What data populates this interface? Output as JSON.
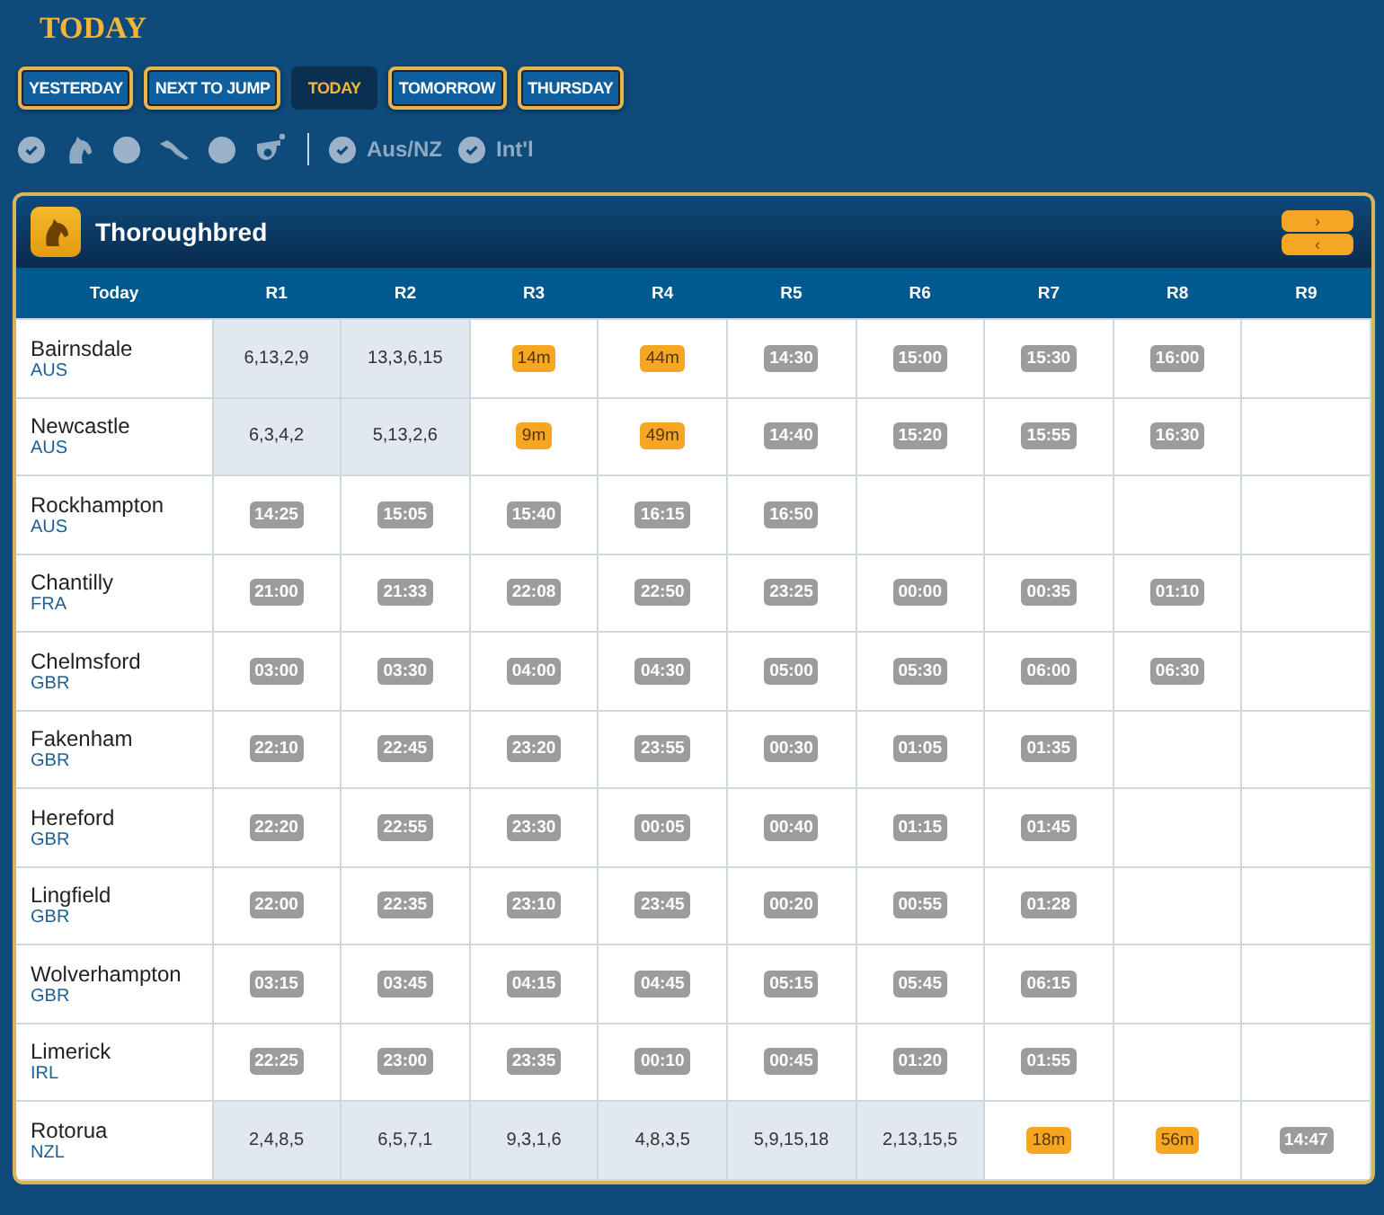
{
  "page_title": "TODAY",
  "day_tabs": [
    {
      "label": "YESTERDAY",
      "selected": false
    },
    {
      "label": "NEXT TO JUMP",
      "selected": false
    },
    {
      "label": "TODAY",
      "selected": true
    },
    {
      "label": "TOMORROW",
      "selected": false
    },
    {
      "label": "THURSDAY",
      "selected": false
    }
  ],
  "type_filters": [
    {
      "kind": "thoroughbred",
      "checked": true
    },
    {
      "kind": "greyhound",
      "checked": false
    },
    {
      "kind": "harness",
      "checked": false
    }
  ],
  "region_filters": [
    {
      "label": "Aus/NZ",
      "checked": true
    },
    {
      "label": "Int'l",
      "checked": true
    }
  ],
  "panel": {
    "title": "Thoroughbred",
    "nav_buttons": [
      "›",
      "‹"
    ],
    "venue_header": "Today",
    "race_headers": [
      "R1",
      "R2",
      "R3",
      "R4",
      "R5",
      "R6",
      "R7",
      "R8",
      "R9"
    ],
    "rows": [
      {
        "venue": "Bairnsdale",
        "country": "AUS",
        "cells": [
          {
            "kind": "result",
            "text": "6,13,2,9"
          },
          {
            "kind": "result",
            "text": "13,3,6,15"
          },
          {
            "kind": "soon",
            "text": "14m"
          },
          {
            "kind": "soon",
            "text": "44m"
          },
          {
            "kind": "time",
            "text": "14:30"
          },
          {
            "kind": "time",
            "text": "15:00"
          },
          {
            "kind": "time",
            "text": "15:30"
          },
          {
            "kind": "time",
            "text": "16:00"
          }
        ]
      },
      {
        "venue": "Newcastle",
        "country": "AUS",
        "cells": [
          {
            "kind": "result",
            "text": "6,3,4,2"
          },
          {
            "kind": "result",
            "text": "5,13,2,6"
          },
          {
            "kind": "soon",
            "text": "9m"
          },
          {
            "kind": "soon",
            "text": "49m"
          },
          {
            "kind": "time",
            "text": "14:40"
          },
          {
            "kind": "time",
            "text": "15:20"
          },
          {
            "kind": "time",
            "text": "15:55"
          },
          {
            "kind": "time",
            "text": "16:30"
          }
        ]
      },
      {
        "venue": "Rockhampton",
        "country": "AUS",
        "cells": [
          {
            "kind": "time",
            "text": "14:25"
          },
          {
            "kind": "time",
            "text": "15:05"
          },
          {
            "kind": "time",
            "text": "15:40"
          },
          {
            "kind": "time",
            "text": "16:15"
          },
          {
            "kind": "time",
            "text": "16:50"
          }
        ]
      },
      {
        "venue": "Chantilly",
        "country": "FRA",
        "cells": [
          {
            "kind": "time",
            "text": "21:00"
          },
          {
            "kind": "time",
            "text": "21:33"
          },
          {
            "kind": "time",
            "text": "22:08"
          },
          {
            "kind": "time",
            "text": "22:50"
          },
          {
            "kind": "time",
            "text": "23:25"
          },
          {
            "kind": "time",
            "text": "00:00"
          },
          {
            "kind": "time",
            "text": "00:35"
          },
          {
            "kind": "time",
            "text": "01:10"
          }
        ]
      },
      {
        "venue": "Chelmsford",
        "country": "GBR",
        "cells": [
          {
            "kind": "time",
            "text": "03:00"
          },
          {
            "kind": "time",
            "text": "03:30"
          },
          {
            "kind": "time",
            "text": "04:00"
          },
          {
            "kind": "time",
            "text": "04:30"
          },
          {
            "kind": "time",
            "text": "05:00"
          },
          {
            "kind": "time",
            "text": "05:30"
          },
          {
            "kind": "time",
            "text": "06:00"
          },
          {
            "kind": "time",
            "text": "06:30"
          }
        ]
      },
      {
        "venue": "Fakenham",
        "country": "GBR",
        "cells": [
          {
            "kind": "time",
            "text": "22:10"
          },
          {
            "kind": "time",
            "text": "22:45"
          },
          {
            "kind": "time",
            "text": "23:20"
          },
          {
            "kind": "time",
            "text": "23:55"
          },
          {
            "kind": "time",
            "text": "00:30"
          },
          {
            "kind": "time",
            "text": "01:05"
          },
          {
            "kind": "time",
            "text": "01:35"
          }
        ]
      },
      {
        "venue": "Hereford",
        "country": "GBR",
        "cells": [
          {
            "kind": "time",
            "text": "22:20"
          },
          {
            "kind": "time",
            "text": "22:55"
          },
          {
            "kind": "time",
            "text": "23:30"
          },
          {
            "kind": "time",
            "text": "00:05"
          },
          {
            "kind": "time",
            "text": "00:40"
          },
          {
            "kind": "time",
            "text": "01:15"
          },
          {
            "kind": "time",
            "text": "01:45"
          }
        ]
      },
      {
        "venue": "Lingfield",
        "country": "GBR",
        "cells": [
          {
            "kind": "time",
            "text": "22:00"
          },
          {
            "kind": "time",
            "text": "22:35"
          },
          {
            "kind": "time",
            "text": "23:10"
          },
          {
            "kind": "time",
            "text": "23:45"
          },
          {
            "kind": "time",
            "text": "00:20"
          },
          {
            "kind": "time",
            "text": "00:55"
          },
          {
            "kind": "time",
            "text": "01:28"
          }
        ]
      },
      {
        "venue": "Wolverhampton",
        "country": "GBR",
        "cells": [
          {
            "kind": "time",
            "text": "03:15"
          },
          {
            "kind": "time",
            "text": "03:45"
          },
          {
            "kind": "time",
            "text": "04:15"
          },
          {
            "kind": "time",
            "text": "04:45"
          },
          {
            "kind": "time",
            "text": "05:15"
          },
          {
            "kind": "time",
            "text": "05:45"
          },
          {
            "kind": "time",
            "text": "06:15"
          }
        ]
      },
      {
        "venue": "Limerick",
        "country": "IRL",
        "cells": [
          {
            "kind": "time",
            "text": "22:25"
          },
          {
            "kind": "time",
            "text": "23:00"
          },
          {
            "kind": "time",
            "text": "23:35"
          },
          {
            "kind": "time",
            "text": "00:10"
          },
          {
            "kind": "time",
            "text": "00:45"
          },
          {
            "kind": "time",
            "text": "01:20"
          },
          {
            "kind": "time",
            "text": "01:55"
          }
        ]
      },
      {
        "venue": "Rotorua",
        "country": "NZL",
        "cells": [
          {
            "kind": "result",
            "text": "2,4,8,5"
          },
          {
            "kind": "result",
            "text": "6,5,7,1"
          },
          {
            "kind": "result",
            "text": "9,3,1,6"
          },
          {
            "kind": "result",
            "text": "4,8,3,5"
          },
          {
            "kind": "result",
            "text": "5,9,15,18"
          },
          {
            "kind": "result",
            "text": "2,13,15,5"
          },
          {
            "kind": "soon",
            "text": "18m"
          },
          {
            "kind": "soon",
            "text": "56m"
          },
          {
            "kind": "time",
            "text": "14:47"
          }
        ]
      }
    ]
  }
}
